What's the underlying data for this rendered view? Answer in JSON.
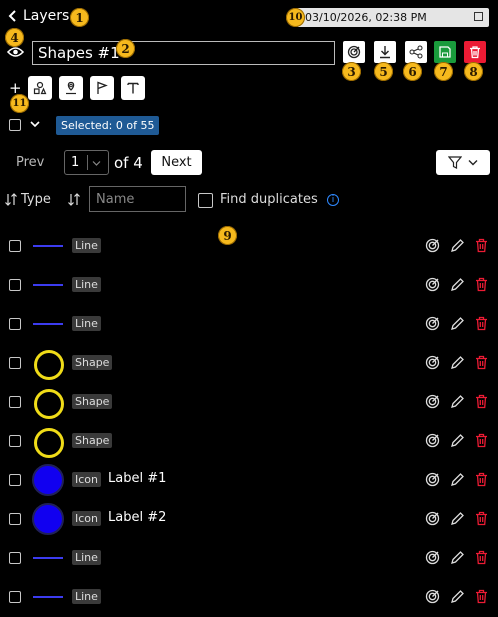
{
  "header": {
    "back_label": "Layers",
    "datetime": "03/10/2026, 02:38 PM"
  },
  "layer": {
    "name": "Shapes #1"
  },
  "toolbar": {
    "add_symbol": "+"
  },
  "selection": {
    "text": "Selected: 0 of 55"
  },
  "pagination": {
    "prev": "Prev",
    "page": "1",
    "of_text": "of 4",
    "next": "Next"
  },
  "columns": {
    "type": "Type",
    "name_placeholder": "Name",
    "find_duplicates": "Find duplicates"
  },
  "rows": [
    {
      "kind": "line",
      "type": "Line",
      "label": ""
    },
    {
      "kind": "line",
      "type": "Line",
      "label": ""
    },
    {
      "kind": "line",
      "type": "Line",
      "label": ""
    },
    {
      "kind": "shape",
      "type": "Shape",
      "label": ""
    },
    {
      "kind": "shape",
      "type": "Shape",
      "label": ""
    },
    {
      "kind": "shape",
      "type": "Shape",
      "label": ""
    },
    {
      "kind": "icon",
      "type": "Icon",
      "label": "Label #1"
    },
    {
      "kind": "icon",
      "type": "Icon",
      "label": "Label #2"
    },
    {
      "kind": "line",
      "type": "Line",
      "label": ""
    },
    {
      "kind": "line",
      "type": "Line",
      "label": ""
    }
  ],
  "markers": [
    "1",
    "2",
    "3",
    "4",
    "5",
    "6",
    "7",
    "8",
    "9",
    "10",
    "11"
  ],
  "colors": {
    "save": "#1a9b3c",
    "delete": "#ec1b34",
    "selected_bg": "#1f5a95",
    "line": "#3c3cf0",
    "shape": "#f0dc18",
    "icon": "#1100f0",
    "marker": "#f6b91d"
  }
}
